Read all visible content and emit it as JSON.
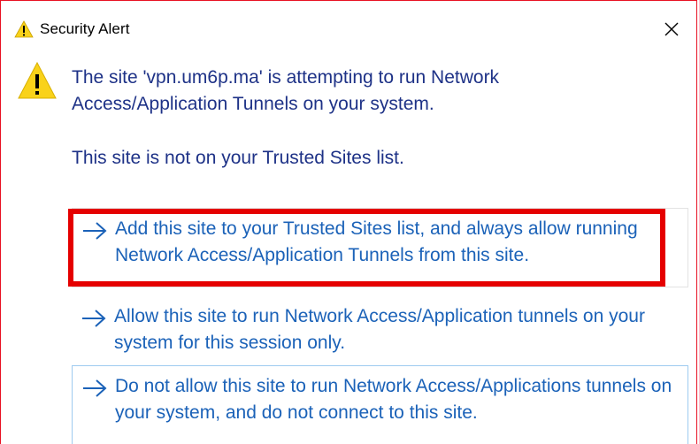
{
  "window": {
    "title": "Security Alert",
    "title_icon": "warning-icon",
    "close_icon": "close-icon"
  },
  "message": {
    "icon": "warning-icon",
    "main": "The site 'vpn.um6p.ma' is attempting to run Network Access/Application Tunnels on your system.",
    "sub": "This site is not on your Trusted Sites list."
  },
  "options": [
    {
      "icon": "arrow-right-icon",
      "label": "Add this site to your Trusted Sites list, and always allow running Network Access/Application Tunnels from this site.",
      "highlighted": true
    },
    {
      "icon": "arrow-right-icon",
      "label": "Allow this site to run Network Access/Application tunnels on your system for this session only."
    },
    {
      "icon": "arrow-right-icon",
      "label": "Do not allow this site to run Network Access/Applications tunnels on your system, and do not connect to this site.",
      "focused": true
    }
  ],
  "colors": {
    "window_border": "#e81123",
    "highlight": "#e50000",
    "message_text": "#1e3287",
    "link_text": "#1b62b8",
    "warning_yellow": "#f9d21a"
  }
}
